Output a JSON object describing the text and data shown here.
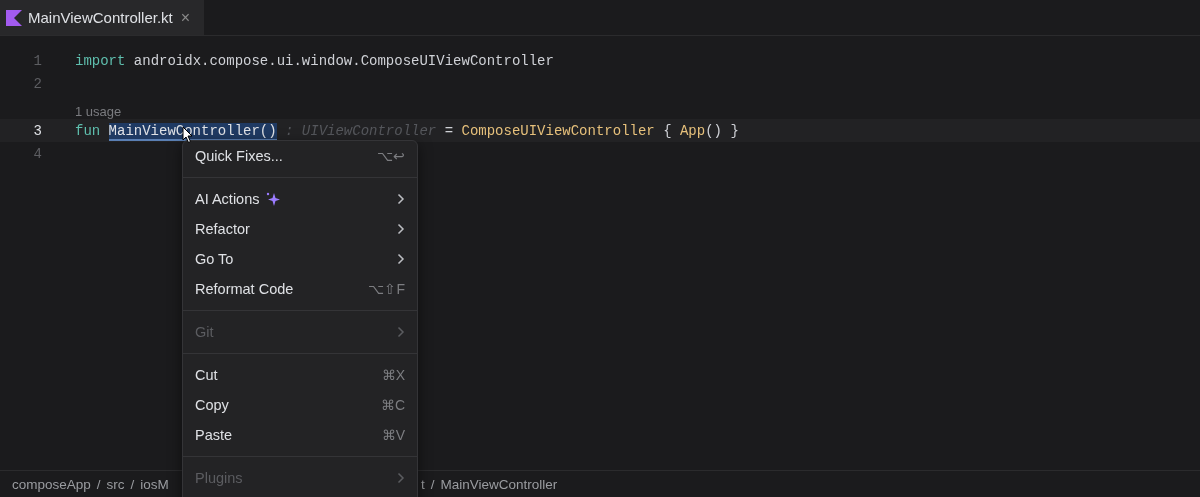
{
  "tab": {
    "label": "MainViewController.kt",
    "close": "×",
    "selected": true
  },
  "lines": [
    {
      "number": "1",
      "current": false,
      "tokens": [
        {
          "kind": "keyword",
          "text": "import"
        },
        {
          "kind": "plain",
          "text": " androidx.compose.ui.window.ComposeUIViewController"
        }
      ]
    },
    {
      "number": "2",
      "current": false
    },
    {
      "number": "3",
      "current": true,
      "usage": "1 usage",
      "tokens": [
        {
          "kind": "keyword",
          "text": "fun "
        },
        {
          "kind": "selected",
          "text": "MainViewController()"
        },
        {
          "kind": "hint",
          "text": " : UIViewController"
        },
        {
          "kind": "plain",
          "text": " = "
        },
        {
          "kind": "call",
          "text": "ComposeUIViewController"
        },
        {
          "kind": "plain",
          "text": " { "
        },
        {
          "kind": "call",
          "text": "App"
        },
        {
          "kind": "plain",
          "text": "() }"
        }
      ]
    },
    {
      "number": "4",
      "current": false
    }
  ],
  "menu": [
    {
      "kind": "item",
      "label": "Quick Fixes...",
      "shortcut": "⌥↩",
      "disabled": false
    },
    {
      "kind": "separator"
    },
    {
      "kind": "submenu",
      "label": "AI Actions",
      "sparkle": true,
      "disabled": false
    },
    {
      "kind": "submenu",
      "label": "Refactor",
      "disabled": false
    },
    {
      "kind": "submenu",
      "label": "Go To",
      "disabled": false
    },
    {
      "kind": "item",
      "label": "Reformat Code",
      "shortcut": "⌥⇧F",
      "disabled": false
    },
    {
      "kind": "separator"
    },
    {
      "kind": "submenu",
      "label": "Git",
      "disabled": true
    },
    {
      "kind": "separator"
    },
    {
      "kind": "item",
      "label": "Cut",
      "shortcut": "⌘X",
      "disabled": false
    },
    {
      "kind": "item",
      "label": "Copy",
      "shortcut": "⌘C",
      "disabled": false
    },
    {
      "kind": "item",
      "label": "Paste",
      "shortcut": "⌘V",
      "disabled": false
    },
    {
      "kind": "separator"
    },
    {
      "kind": "submenu",
      "label": "Plugins",
      "disabled": true
    }
  ],
  "breadcrumbs_left": [
    "composeApp",
    "/",
    "src",
    "/",
    "iosM"
  ],
  "breadcrumbs_right": [
    "t",
    "/",
    "MainViewController"
  ]
}
